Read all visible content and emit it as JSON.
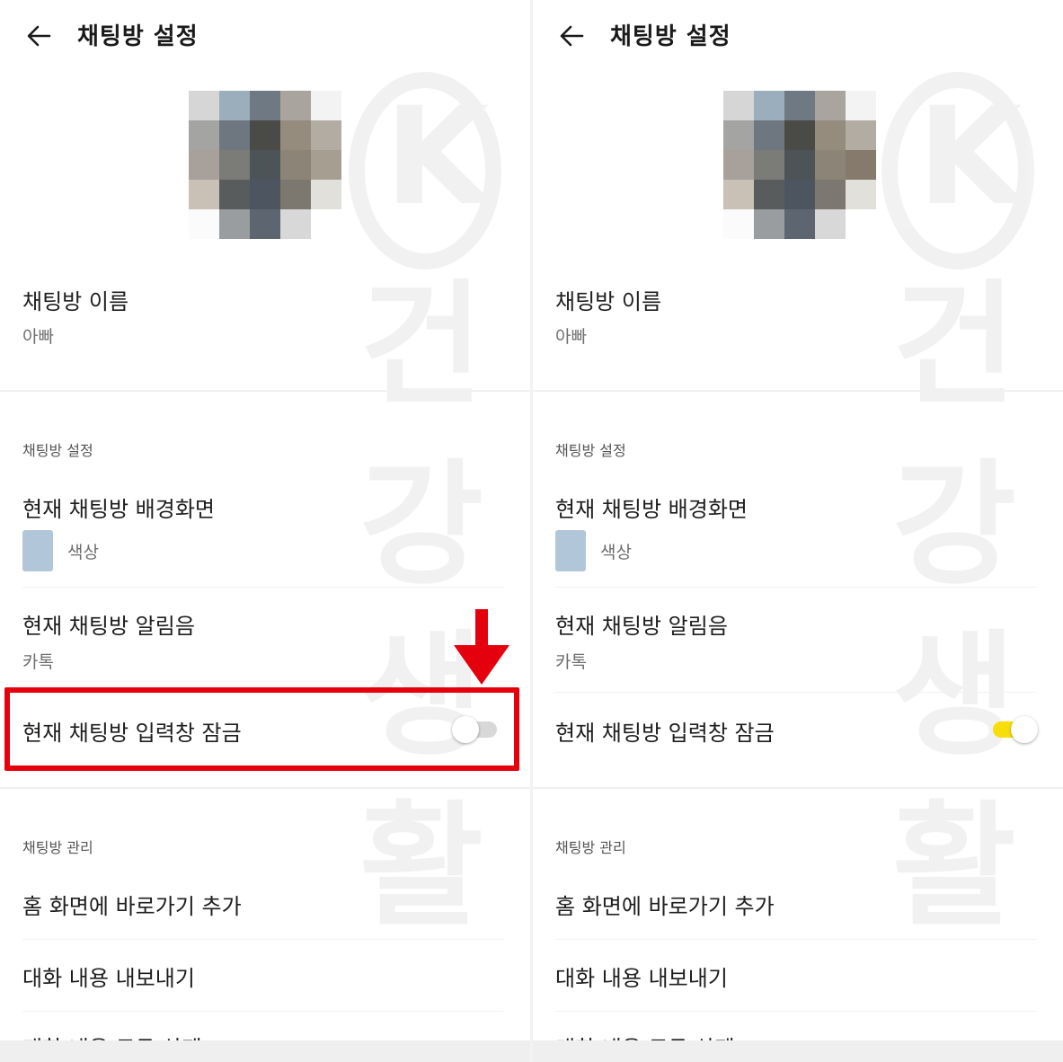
{
  "header": {
    "title": "채팅방 설정",
    "back_icon": "arrow-left-icon"
  },
  "chat_name": {
    "label": "채팅방 이름",
    "value": "아빠"
  },
  "settings_section": {
    "header": "채팅방 설정",
    "background": {
      "label": "현재 채팅방 배경화면",
      "swatch_label": "색상",
      "swatch_color": "#b2c6da"
    },
    "sound": {
      "label": "현재 채팅방 알림음",
      "value": "카톡"
    },
    "lock": {
      "label": "현재 채팅방 입력창 잠금"
    }
  },
  "manage_section": {
    "header": "채팅방 관리",
    "items": [
      "홈 화면에 바로가기 추가",
      "대화 내용 내보내기",
      "대화 내용 모두 삭제"
    ]
  },
  "panels": [
    {
      "lock_enabled": false,
      "highlighted": true
    },
    {
      "lock_enabled": true,
      "highlighted": false
    }
  ],
  "watermark": {
    "letter": "K",
    "chars": [
      "건",
      "강",
      "생",
      "활"
    ]
  },
  "colors": {
    "toggle_on": "#f7de0b",
    "toggle_off": "#d8d8d8",
    "highlight": "#e5000d"
  }
}
